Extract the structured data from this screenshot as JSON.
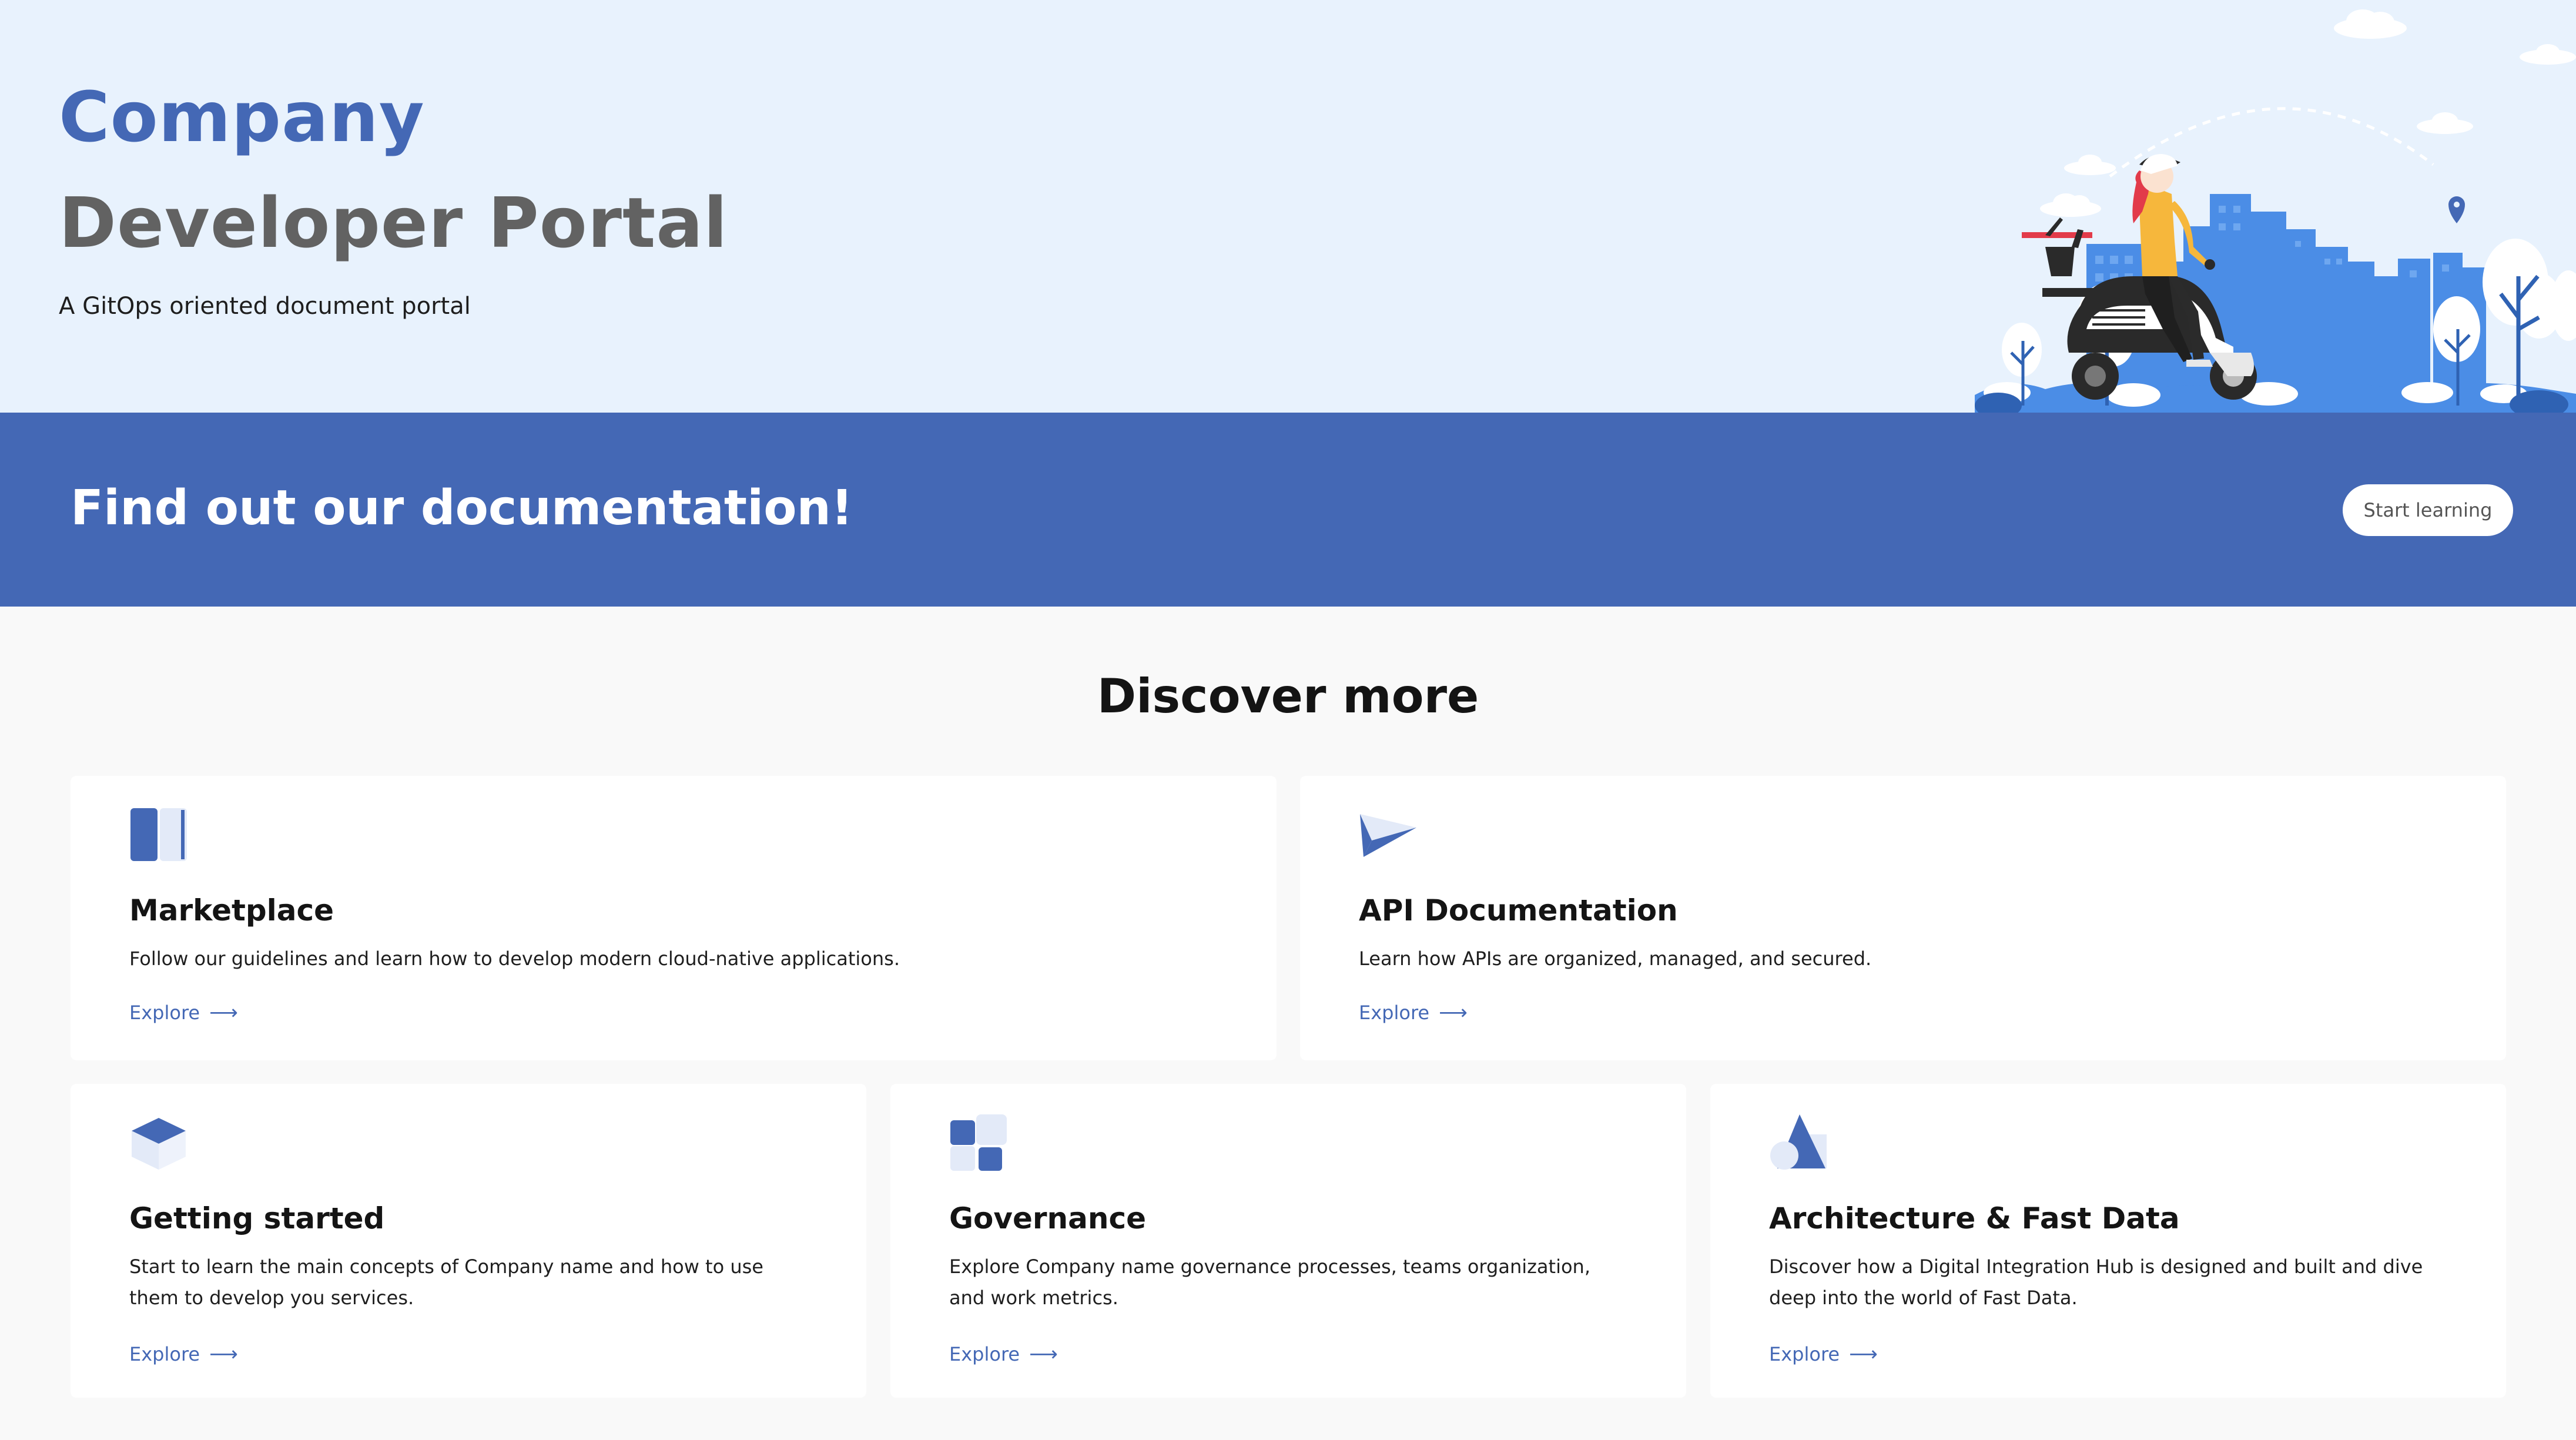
{
  "hero": {
    "title_line1": "Company",
    "title_line2": "Developer Portal",
    "subtitle": "A GitOps oriented document portal",
    "illustration": "delivery-scooter-city-illustration"
  },
  "banner": {
    "title": "Find out our documentation!",
    "button_label": "Start learning"
  },
  "discover": {
    "title": "Discover more",
    "cards": [
      {
        "icon": "book-icon",
        "title": "Marketplace",
        "description": "Follow our guidelines and learn how to develop modern cloud-native applications.",
        "link": "Explore"
      },
      {
        "icon": "paper-plane-icon",
        "title": "API Documentation",
        "description": "Learn how APIs are organized, managed, and secured.",
        "link": "Explore"
      },
      {
        "icon": "cube-icon",
        "title": "Getting started",
        "description": "Start to learn the main concepts of Company name and how to use them to develop you services.",
        "link": "Explore"
      },
      {
        "icon": "blocks-icon",
        "title": "Governance",
        "description": "Explore Company name governance processes, teams organization, and work metrics.",
        "link": "Explore"
      },
      {
        "icon": "shapes-icon",
        "title": "Architecture & Fast Data",
        "description": "Discover how a Digital Integration Hub is designed and built and dive deep into the world of Fast Data.",
        "link": "Explore"
      }
    ]
  },
  "colors": {
    "accent": "#4468b5",
    "hero_bg": "#e8f2fd",
    "page_bg": "#f9f9f9",
    "card_bg": "#ffffff",
    "title_grey": "#626262"
  }
}
